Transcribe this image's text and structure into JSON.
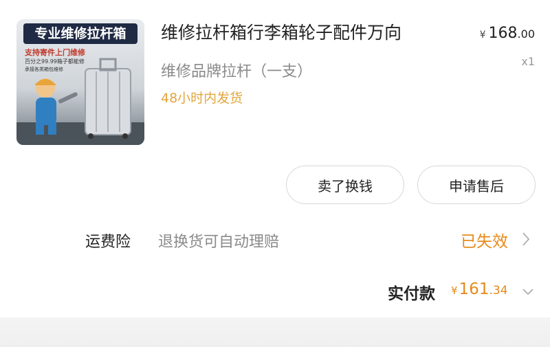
{
  "product": {
    "image_banner": "专业维修拉杆箱",
    "image_sub1": "支持寄件上门维修",
    "image_sub2": "百分之99.99箱子都能修",
    "image_sub3": "承接各类箱包维修",
    "title": "维修拉杆箱行李箱轮子配件万向",
    "spec": "维修品牌拉杆（一支）",
    "shipping_note": "48小时内发货",
    "price_symbol": "¥",
    "price_main": "168",
    "price_cents": ".00",
    "quantity": "x1"
  },
  "actions": {
    "sell_label": "卖了换钱",
    "after_sales_label": "申请售后"
  },
  "insurance": {
    "label": "运费险",
    "description": "退换货可自动理赔",
    "status": "已失效"
  },
  "payment": {
    "label": "实付款",
    "symbol": "¥",
    "amount_main": "161",
    "amount_cents": ".34"
  },
  "colors": {
    "accent_orange": "#e68a1a",
    "shipping_yellow": "#e2a63c",
    "muted_gray": "#8a8a8a"
  }
}
